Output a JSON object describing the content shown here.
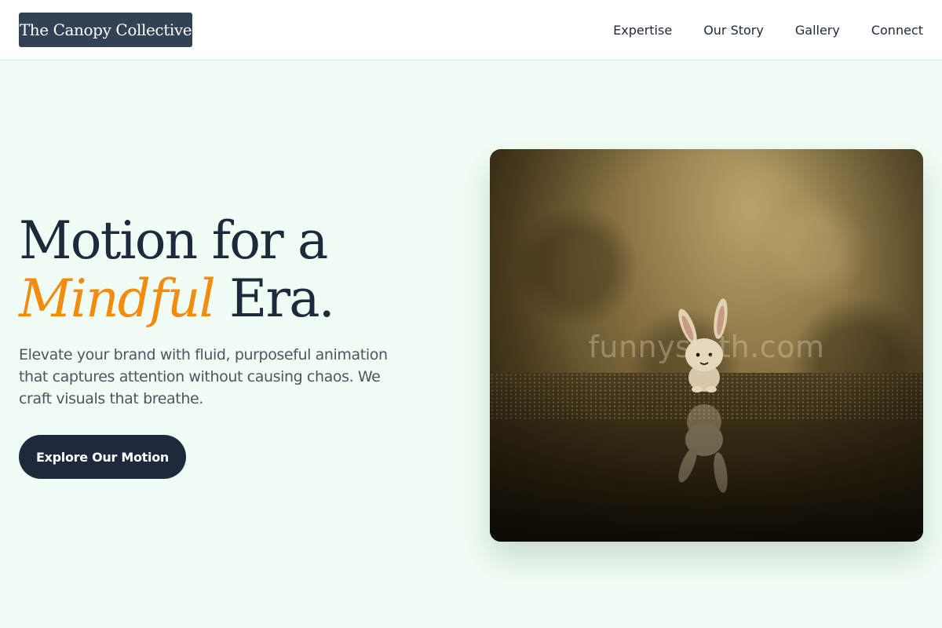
{
  "brand": {
    "logo_text": "The Canopy Collective"
  },
  "nav": {
    "items": [
      {
        "label": "Expertise"
      },
      {
        "label": "Our Story"
      },
      {
        "label": "Gallery"
      },
      {
        "label": "Connect"
      }
    ]
  },
  "hero": {
    "headline_line1": "Motion for a",
    "headline_accent": "Mindful",
    "headline_rest": " Era.",
    "subtext": "Elevate your brand with fluid, purposeful animation that captures attention without causing chaos. We craft visuals that breathe.",
    "cta_label": "Explore Our Motion",
    "image_watermark": "funnysloth.com"
  },
  "colors": {
    "page_background": "#f0fdf4",
    "header_background": "#ffffff",
    "logo_background": "#334155",
    "headline_text": "#1e293b",
    "accent": "#f28c0f",
    "body_text": "#4b5563",
    "cta_background": "#1e293b"
  }
}
